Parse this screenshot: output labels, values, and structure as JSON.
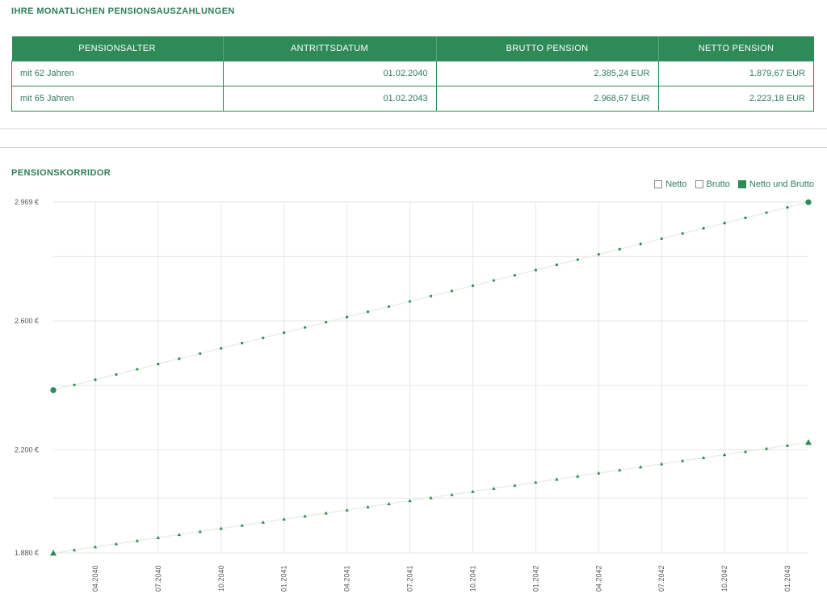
{
  "payouts": {
    "title": "IHRE MONATLICHEN PENSIONSAUSZAHLUNGEN",
    "columns": [
      "PENSIONSALTER",
      "ANTRITTSDATUM",
      "BRUTTO PENSION",
      "NETTO PENSION"
    ],
    "rows": [
      [
        "mit 62 Jahren",
        "01.02.2040",
        "2.385,24 EUR",
        "1.879,67 EUR"
      ],
      [
        "mit 65 Jahren",
        "01.02.2043",
        "2.968,67 EUR",
        "2.223,18 EUR"
      ]
    ]
  },
  "corridor": {
    "title": "PENSIONSKORRIDOR",
    "legend": [
      "Netto",
      "Brutto",
      "Netto und Brutto"
    ],
    "legend_active": "Netto und Brutto"
  },
  "colors": {
    "accent": "#2e8a57",
    "text": "#2e7d5b",
    "grid": "#e6e6e6"
  },
  "chart_data": {
    "type": "scatter",
    "title": "PENSIONSKORRIDOR",
    "y_ticks": [
      "1.880 €",
      "2.200 €",
      "2.600 €",
      "2.969 €"
    ],
    "y_tick_values": [
      1880,
      2200,
      2600,
      2969
    ],
    "ylim": [
      1880,
      2969
    ],
    "x_ticks": [
      "04.2040",
      "07.2040",
      "10.2040",
      "01.2041",
      "04.2041",
      "07.2041",
      "10.2041",
      "01.2042",
      "04.2042",
      "07.2042",
      "10.2042",
      "01.2043"
    ],
    "x_start": "02.2040",
    "x_end": "02.2043",
    "grid": true,
    "legend_position": "top-right",
    "series": [
      {
        "name": "Brutto",
        "marker": "circle",
        "start": 2385.24,
        "end": 2968.67,
        "points": 37
      },
      {
        "name": "Netto",
        "marker": "triangle",
        "start": 1879.67,
        "end": 2223.18,
        "points": 37
      }
    ]
  }
}
